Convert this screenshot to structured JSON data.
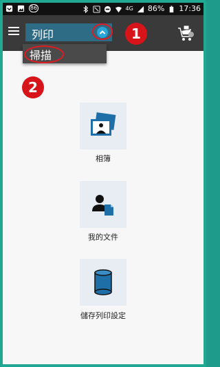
{
  "status_bar": {
    "notification_count": "86",
    "battery_percent": "86%",
    "time": "17:36",
    "network_label": "4G"
  },
  "app_bar": {
    "mode_selected": "列印",
    "menu_icon": "hamburger-menu-icon",
    "chevron_icon": "chevron-up-icon",
    "right_icon": "printer-cart-icon"
  },
  "dropdown": {
    "options": [
      "掃描"
    ]
  },
  "annotations": {
    "badge_1": "1",
    "badge_2": "2",
    "color": "#d7141a"
  },
  "menu_items": [
    {
      "label": "相簿",
      "icon": "photo-album-icon"
    },
    {
      "label": "我的文件",
      "icon": "my-documents-icon"
    },
    {
      "label": "儲存列印設定",
      "icon": "database-cylinder-icon"
    }
  ],
  "colors": {
    "app_bar": "#3a3a3a",
    "dropdown_trigger": "#2e6b84",
    "accent": "#2aa6d8",
    "tile_bg": "#e7edf3",
    "icon_blue": "#1e6ea7"
  }
}
